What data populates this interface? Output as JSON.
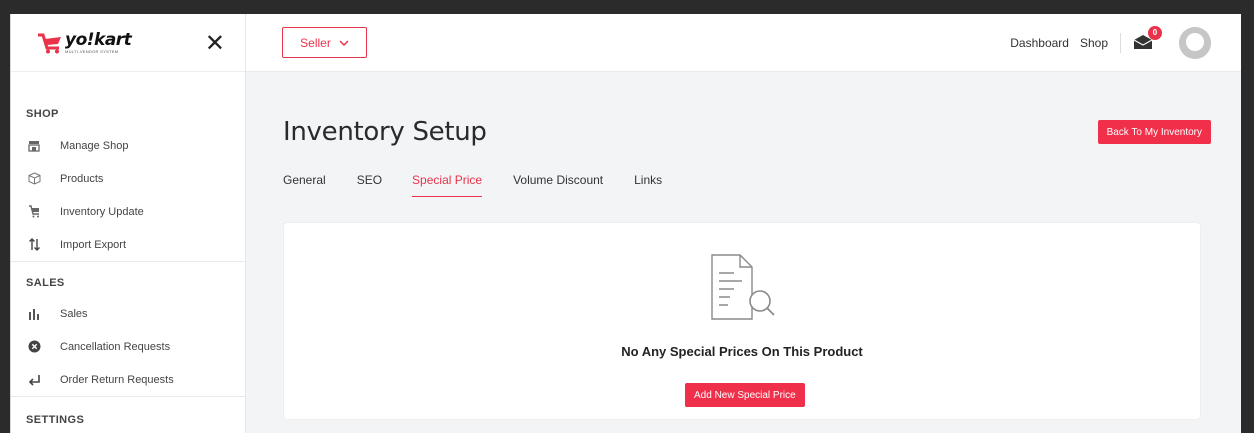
{
  "brand": {
    "name": "yo!kart",
    "tagline": "MULTI-VENDOR SYSTEM",
    "accent": "#e8334a"
  },
  "sidebar": {
    "sections": [
      {
        "title": "SHOP",
        "items": [
          {
            "label": "Manage Shop",
            "icon": "shop-icon"
          },
          {
            "label": "Products",
            "icon": "box-icon"
          },
          {
            "label": "Inventory Update",
            "icon": "cart-icon"
          },
          {
            "label": "Import Export",
            "icon": "arrows-updown-icon"
          }
        ]
      },
      {
        "title": "SALES",
        "items": [
          {
            "label": "Sales",
            "icon": "bar-chart-icon"
          },
          {
            "label": "Cancellation Requests",
            "icon": "cancel-circle-icon"
          },
          {
            "label": "Order Return Requests",
            "icon": "return-arrow-icon"
          }
        ]
      },
      {
        "title": "SETTINGS",
        "items": []
      }
    ]
  },
  "header": {
    "role_selector": "Seller",
    "links": [
      "Dashboard",
      "Shop"
    ],
    "notification_count": "0"
  },
  "main": {
    "title": "Inventory Setup",
    "back_button": "Back To My Inventory",
    "tabs": [
      {
        "label": "General",
        "active": false
      },
      {
        "label": "SEO",
        "active": false
      },
      {
        "label": "Special Price",
        "active": true
      },
      {
        "label": "Volume Discount",
        "active": false
      },
      {
        "label": "Links",
        "active": false
      }
    ],
    "empty_state": {
      "message": "No Any Special Prices On This Product",
      "button": "Add New Special Price",
      "icon": "document-search-icon"
    }
  }
}
